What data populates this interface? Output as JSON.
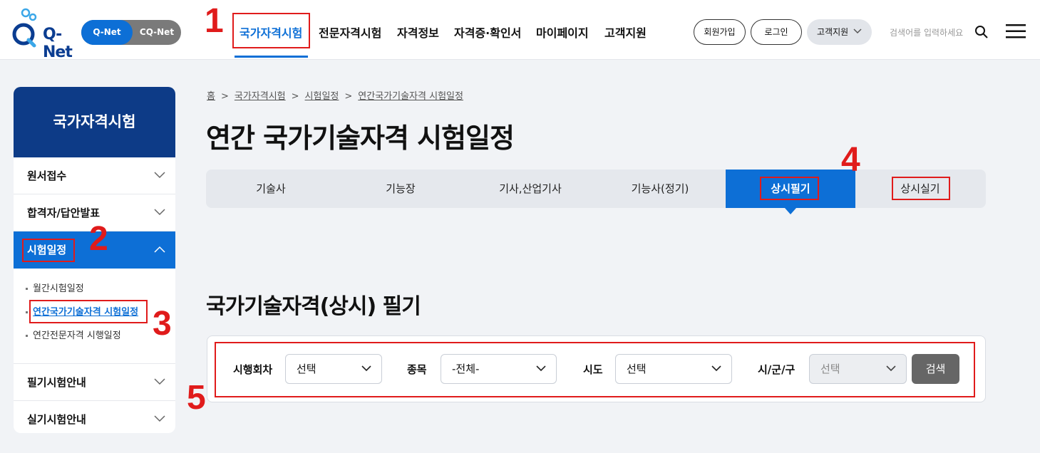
{
  "header": {
    "logo_text": "Q-Net",
    "toggle": {
      "active": "Q-Net",
      "inactive": "CQ-Net"
    },
    "nav": [
      "국가자격시험",
      "전문자격시험",
      "자격정보",
      "자격증·확인서",
      "마이페이지",
      "고객지원"
    ],
    "signup": "회원가입",
    "login": "로그인",
    "support": "고객지원",
    "search_placeholder": "검색어를 입력하세요"
  },
  "sidebar": {
    "title": "국가자격시험",
    "items": [
      "원서접수",
      "합격자/답안발표",
      "시험일정",
      "필기시험안내",
      "실기시험안내"
    ],
    "sub_items": [
      "월간시험일정",
      "연간국가기술자격 시험일정",
      "연간전문자격 시행일정"
    ]
  },
  "breadcrumb": [
    "홈",
    "국가자격시험",
    "시험일정",
    "연간국가기술자격 시험일정"
  ],
  "page_title": "연간 국가기술자격 시험일정",
  "tabs": [
    "기술사",
    "기능장",
    "기사,산업기사",
    "기능사(정기)",
    "상시필기",
    "상시실기"
  ],
  "section_title": "국가기술자격(상시) 필기",
  "filters": {
    "round_label": "시행회차",
    "round_value": "선택",
    "item_label": "종목",
    "item_value": "-전체-",
    "sido_label": "시도",
    "sido_value": "선택",
    "sigungu_label": "시/군/구",
    "sigungu_value": "선택",
    "search_button": "검색"
  },
  "annotations": [
    "1",
    "2",
    "3",
    "4",
    "5"
  ],
  "colors": {
    "primary": "#0d6fd6",
    "navy": "#0d3b87",
    "annotation": "#e01b1b"
  }
}
